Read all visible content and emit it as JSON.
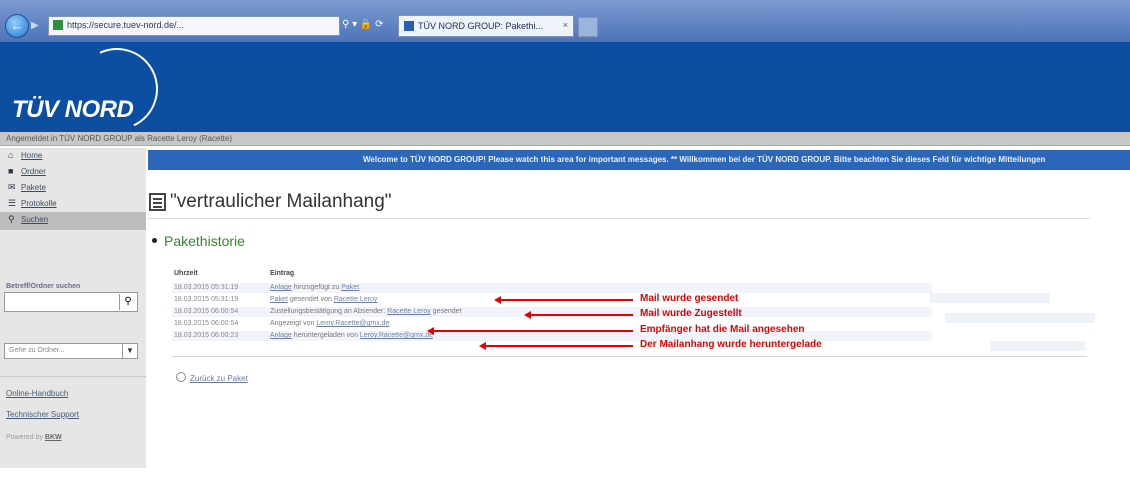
{
  "browser": {
    "url": "https://secure.tuev-nord.de/...",
    "tab_title": "TÜV NORD GROUP: Pakethi..."
  },
  "header": {
    "logo_text": "TÜV NORD"
  },
  "login_bar": {
    "text": "Angemeldet in TÜV NORD GROUP als Racette Leroy (Racette)"
  },
  "sidebar": {
    "nav": [
      {
        "icon": "home-icon",
        "label": "Home"
      },
      {
        "icon": "folder-icon",
        "label": "Ordner"
      },
      {
        "icon": "package-icon",
        "label": "Pakete"
      },
      {
        "icon": "log-icon",
        "label": "Protokolle"
      },
      {
        "icon": "search-icon",
        "label": "Suchen"
      }
    ],
    "search_label": "Betreff/Ordner suchen",
    "search_placeholder": "",
    "select_value": "Gehe zu Ordner...",
    "links": [
      "Online-Handbuch",
      "Technischer Support"
    ],
    "powered_prefix": "Powered by",
    "powered_brand": "BKW"
  },
  "welcome": "Welcome to TÜV NORD GROUP! Please watch this area for important messages. ** Willkommen bei der TÜV NORD GROUP. Bitte beachten Sie dieses Feld für wichtige Mitteilungen",
  "page_title": "\"vertraulicher Mailanhang\"",
  "section_title": "Pakethistorie",
  "history": {
    "headers": [
      "Uhrzeit",
      "Eintrag"
    ],
    "rows": [
      {
        "time": "18.03.2015 05:31:19",
        "link": "Anlage",
        "text": " hinzugefügt zu ",
        "link2": "Paket",
        "text2": ""
      },
      {
        "time": "18.03.2015 05:31:19",
        "link": "Paket",
        "text": " gesendet von ",
        "link2": "Racette Leroy",
        "text2": ""
      },
      {
        "time": "18.03.2015 06:00:54",
        "link": "",
        "text": "Zustellungsbestätigung an Absender: ",
        "link2": "Racette Leroy",
        "text2": " gesendet"
      },
      {
        "time": "18.03.2015 06:00:54",
        "link": "",
        "text": "Angezeigt von ",
        "link2": "Leroy.Racette@gmx.de",
        "text2": ""
      },
      {
        "time": "18.03.2015 06:00:23",
        "link": "Anlage",
        "text": " heruntergeladen von ",
        "link2": "Leroy.Racette@gmx.de",
        "text2": ""
      }
    ]
  },
  "back_link": "Zurück zu Paket",
  "annotations": [
    "Mail wurde gesendet",
    "Mail wurde Zugestellt",
    "Empfänger hat die Mail angesehen",
    "Der Mailanhang wurde heruntergelade"
  ],
  "colors": {
    "header_blue": "#0b4ea2",
    "welcome_blue": "#2c66b8",
    "section_green": "#2f8a2f",
    "annotation_red": "#e60000"
  }
}
